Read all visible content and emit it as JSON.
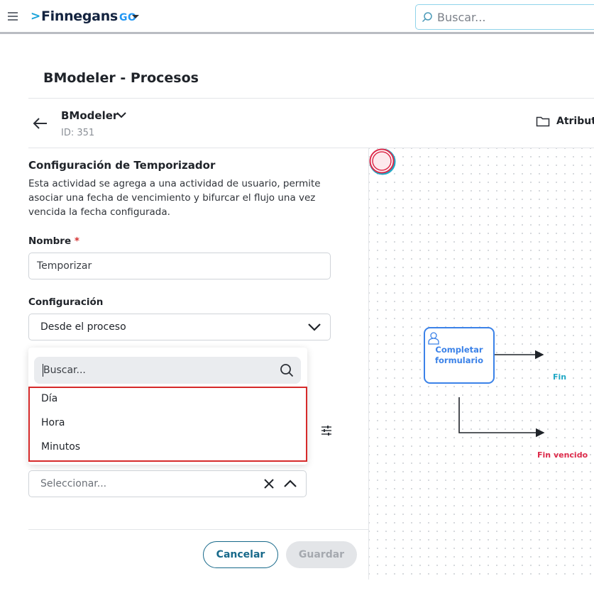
{
  "topbar": {
    "brand_name": "Finnegans",
    "brand_suffix": "GO",
    "search_placeholder": "Buscar..."
  },
  "page": {
    "title": "BModeler - Procesos"
  },
  "model": {
    "name": "BModeler",
    "id_label": "ID: 351",
    "attributes_label": "Atributos"
  },
  "timer_config": {
    "title": "Configuración de Temporizador",
    "description": "Esta actividad se agrega a una actividad de usuario, permite asociar una fecha de vencimiento y bifurcar el flujo una vez vencida la fecha configurada.",
    "name_label": "Nombre",
    "required_mark": "*",
    "name_value": "Temporizar",
    "config_label": "Configuración",
    "config_value": "Desde el proceso",
    "dropdown": {
      "search_placeholder": "Buscar...",
      "options": [
        "Día",
        "Hora",
        "Minutos"
      ]
    },
    "unit_placeholder": "Seleccionar...",
    "cancel_label": "Cancelar",
    "save_label": "Guardar"
  },
  "diagram": {
    "task_label_line1": "Completar",
    "task_label_line2": "formulario",
    "end_label": "Fin",
    "expired_end_label": "Fin vencido"
  },
  "colors": {
    "accent": "#17698a",
    "task_blue": "#3b82e8",
    "end_teal": "#20a8c5",
    "end_red": "#dd2a4a",
    "highlight_red": "#d62a2a"
  }
}
